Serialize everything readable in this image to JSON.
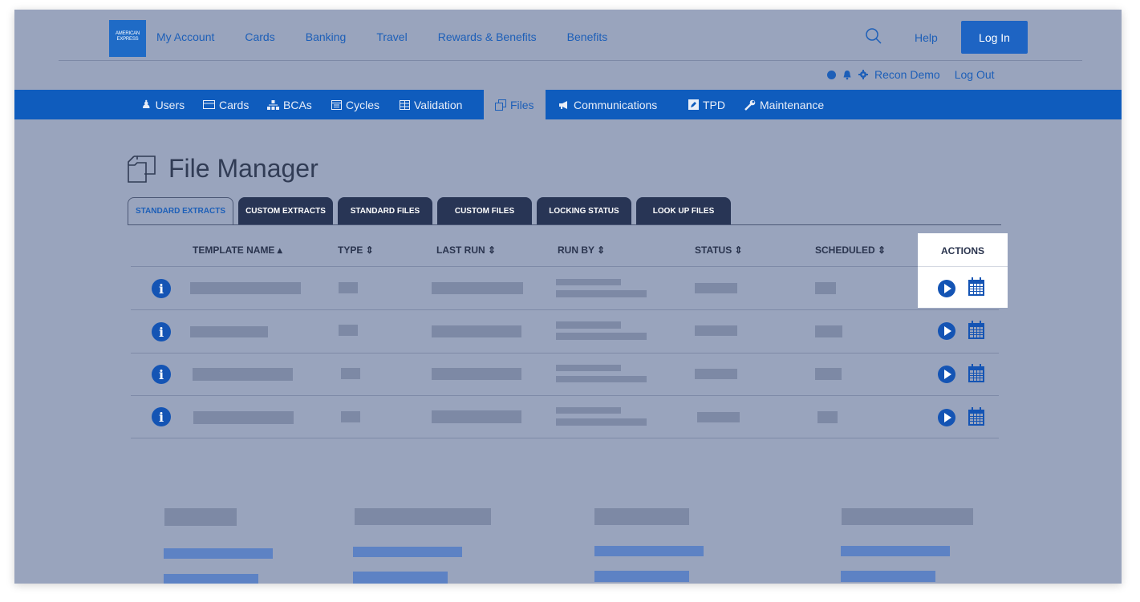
{
  "brand": {
    "logo_text": "AMERICAN EXPRESS"
  },
  "nav": [
    "My Account",
    "Cards",
    "Banking",
    "Travel",
    "Rewards & Benefits",
    "Benefits"
  ],
  "header": {
    "help": "Help",
    "login": "Log In",
    "user": "Recon Demo",
    "logout": "Log Out"
  },
  "subnav": {
    "users": "Users",
    "cards": "Cards",
    "bcas": "BCAs",
    "cycles": "Cycles",
    "validation": "Validation",
    "files": "Files",
    "communications": "Communications",
    "tpd": "TPD",
    "maintenance": "Maintenance"
  },
  "page": {
    "title": "File Manager"
  },
  "tabs": [
    "STANDARD EXTRACTS",
    "CUSTOM EXTRACTS",
    "STANDARD FILES",
    "CUSTOM FILES",
    "LOCKING STATUS",
    "LOOK UP FILES"
  ],
  "columns": [
    "TEMPLATE NAME",
    "TYPE",
    "LAST RUN",
    "RUN BY",
    "STATUS",
    "SCHEDULED",
    "ACTIONS"
  ],
  "colors": {
    "accent": "#1e64c3",
    "navbar": "#0f5cbd",
    "overlay": "#99a4bd"
  },
  "icons": [
    "search-icon",
    "bell-icon",
    "gear-icon",
    "files-icon",
    "info-icon",
    "play-icon",
    "calendar-icon"
  ]
}
